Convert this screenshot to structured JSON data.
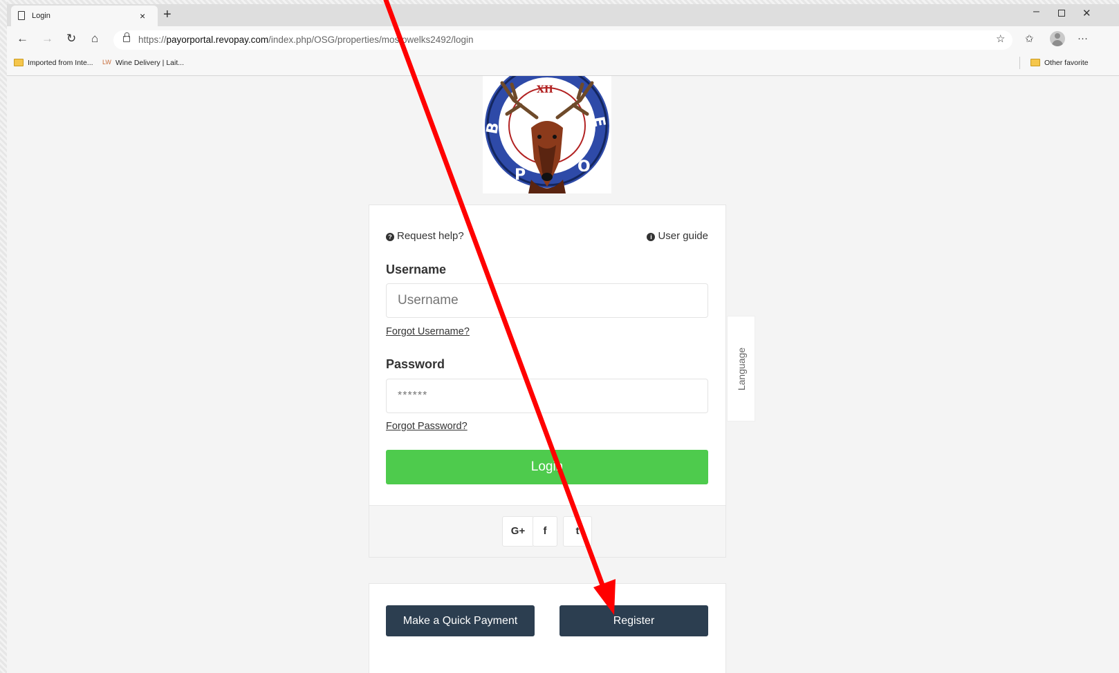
{
  "browser": {
    "tab_title": "Login",
    "tab_close": "×",
    "new_tab": "+",
    "url_scheme": "https://",
    "url_host": "payorportal.revopay.com",
    "url_path": "/index.php/OSG/properties/mostowelks2492/login",
    "more": "···",
    "favorites": [
      {
        "label": "Imported from Inte...",
        "icon": "folder-icon"
      },
      {
        "label": "Wine Delivery | Lait...",
        "icon": "lw-icon"
      }
    ],
    "other_favorites": "Other favorite"
  },
  "logo": {
    "letters": [
      "B",
      "P",
      "O",
      "E"
    ],
    "dial": "XII"
  },
  "login": {
    "request_help": "Request help?",
    "user_guide": "User guide",
    "username_label": "Username",
    "username_placeholder": "Username",
    "forgot_username": "Forgot Username?",
    "password_label": "Password",
    "password_placeholder": "******",
    "forgot_password": "Forgot Password?",
    "login_button": "Login",
    "social": [
      {
        "label": "G+",
        "icon": "google-plus-icon"
      },
      {
        "label": "f",
        "icon": "facebook-icon"
      },
      {
        "label": "t",
        "icon": "twitter-icon"
      }
    ]
  },
  "language_tab": "Language",
  "actions": {
    "quick_payment": "Make a Quick Payment",
    "register": "Register"
  },
  "colors": {
    "login_green": "#4ecb4d",
    "dark_button": "#2c3e50",
    "annotation_arrow": "#ff0000"
  }
}
